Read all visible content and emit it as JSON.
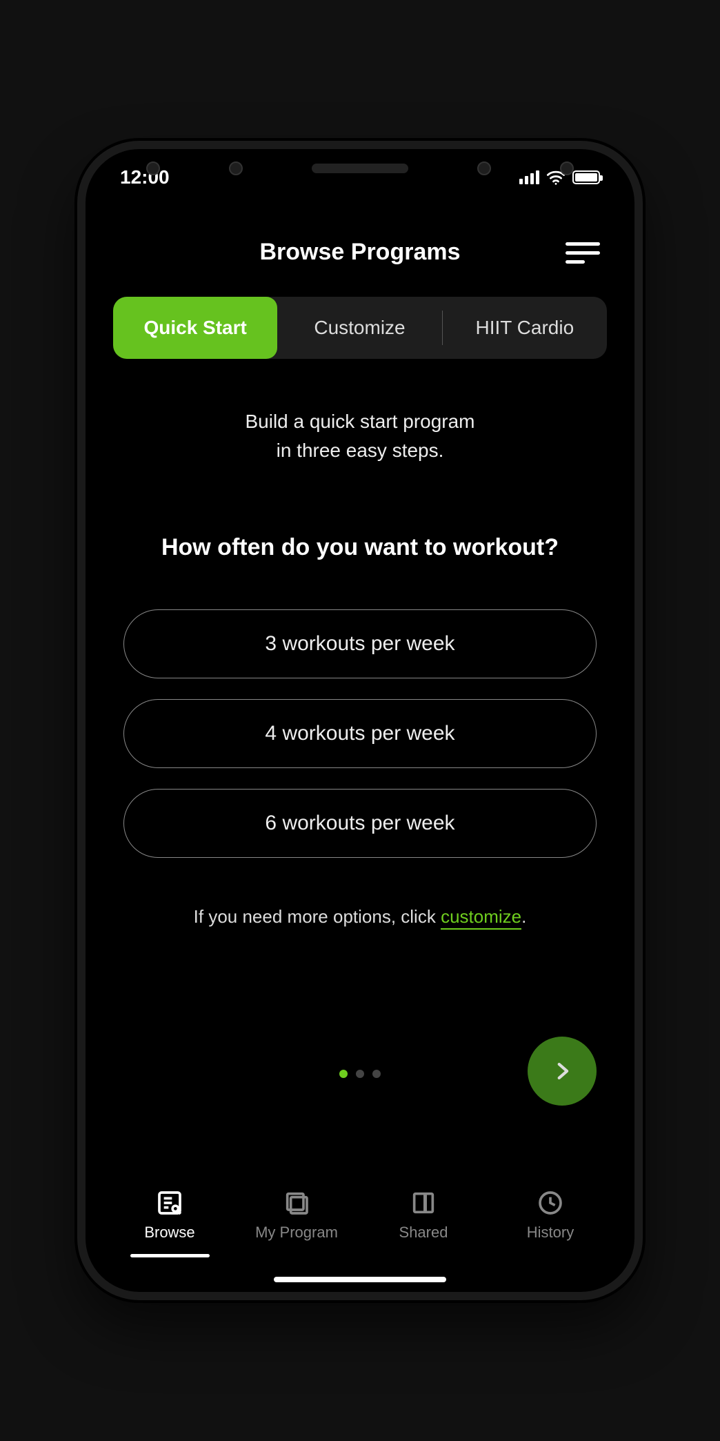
{
  "status": {
    "time": "12:00"
  },
  "header": {
    "title": "Browse Programs"
  },
  "segments": {
    "items": [
      {
        "label": "Quick Start",
        "active": true
      },
      {
        "label": "Customize",
        "active": false
      },
      {
        "label": "HIIT Cardio",
        "active": false
      }
    ]
  },
  "intro": {
    "line1": "Build a quick start program",
    "line2": "in three easy steps."
  },
  "question": "How often do you want to workout?",
  "options": [
    "3 workouts per week",
    "4 workouts per week",
    "6 workouts per week"
  ],
  "hint": {
    "prefix": "If you need more options, click ",
    "link": "customize",
    "suffix": "."
  },
  "pager": {
    "count": 3,
    "active": 0
  },
  "tabs": [
    {
      "label": "Browse",
      "active": true
    },
    {
      "label": "My Program",
      "active": false
    },
    {
      "label": "Shared",
      "active": false
    },
    {
      "label": "History",
      "active": false
    }
  ],
  "colors": {
    "accent": "#66c21f"
  }
}
